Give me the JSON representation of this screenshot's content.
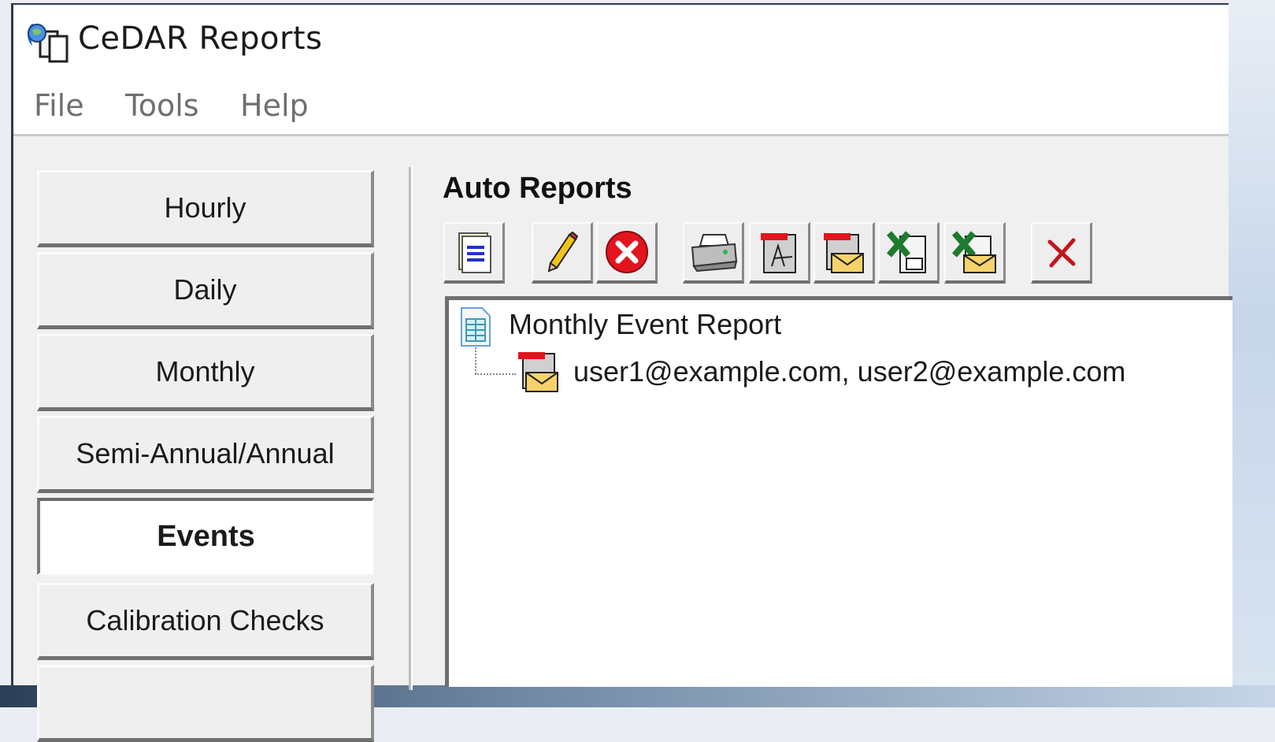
{
  "window": {
    "title": "CeDAR Reports",
    "icon": "cedar-app-icon"
  },
  "menu": {
    "items": [
      {
        "label": "File"
      },
      {
        "label": "Tools"
      },
      {
        "label": "Help"
      }
    ]
  },
  "nav": {
    "items": [
      {
        "label": "Hourly",
        "active": false
      },
      {
        "label": "Daily",
        "active": false
      },
      {
        "label": "Monthly",
        "active": false
      },
      {
        "label": "Semi-Annual/Annual",
        "active": false
      },
      {
        "label": "Events",
        "active": true
      },
      {
        "label": "Calibration Checks",
        "active": false
      },
      {
        "label": "",
        "active": false
      }
    ]
  },
  "auto_reports": {
    "title": "Auto Reports",
    "toolbar": [
      {
        "name": "new-report",
        "icon": "document-list-icon"
      },
      {
        "name": "edit-report",
        "icon": "pencil-icon"
      },
      {
        "name": "delete-report",
        "icon": "red-x-circle-icon"
      },
      {
        "name": "add-printer",
        "icon": "printer-icon"
      },
      {
        "name": "add-pdf",
        "icon": "pdf-icon"
      },
      {
        "name": "add-pdf-email",
        "icon": "pdf-email-icon"
      },
      {
        "name": "add-excel",
        "icon": "excel-icon"
      },
      {
        "name": "add-excel-email",
        "icon": "excel-email-icon"
      },
      {
        "name": "remove-output",
        "icon": "red-x-icon"
      }
    ],
    "tree": [
      {
        "label": "Monthly Event Report",
        "icon": "report-document-icon",
        "children": [
          {
            "label": "user1@example.com, user2@example.com",
            "icon": "pdf-email-icon"
          }
        ]
      }
    ]
  },
  "colors": {
    "window_bg": "#f0f0f0",
    "accent_red": "#e3141d",
    "excel_green": "#1e7a2e",
    "menu_text": "#6f6f6f"
  }
}
